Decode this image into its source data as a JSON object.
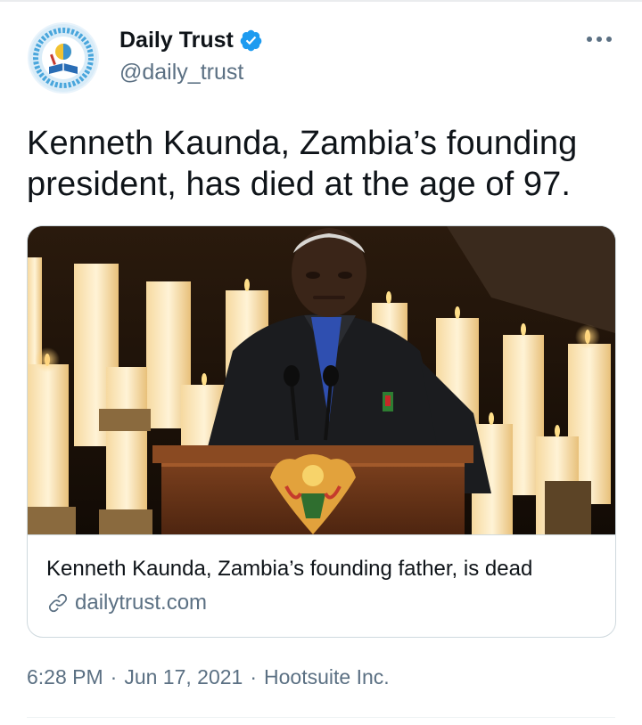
{
  "tweet": {
    "author": {
      "display_name": "Daily Trust",
      "handle": "@daily_trust",
      "verified": true,
      "avatar_icon": "daily-trust-logo",
      "verified_icon": "verified-badge-icon",
      "verified_color": "#1d9bf0"
    },
    "more_icon": "more-options-icon",
    "text": "Kenneth Kaunda, Zambia’s founding president, has died at the age of 97.",
    "card": {
      "title": "Kenneth Kaunda, Zambia’s founding father, is dead",
      "domain": "dailytrust.com",
      "link_icon": "link-icon",
      "image_description_icon": "photo"
    },
    "time": "6:28 PM",
    "date": "Jun 17, 2021",
    "source_app": "Hootsuite Inc.",
    "separator": "·"
  },
  "colors": {
    "text_primary": "#0f1419",
    "text_secondary": "#5b7083",
    "border": "#cfd9de",
    "accent": "#1d9bf0"
  }
}
